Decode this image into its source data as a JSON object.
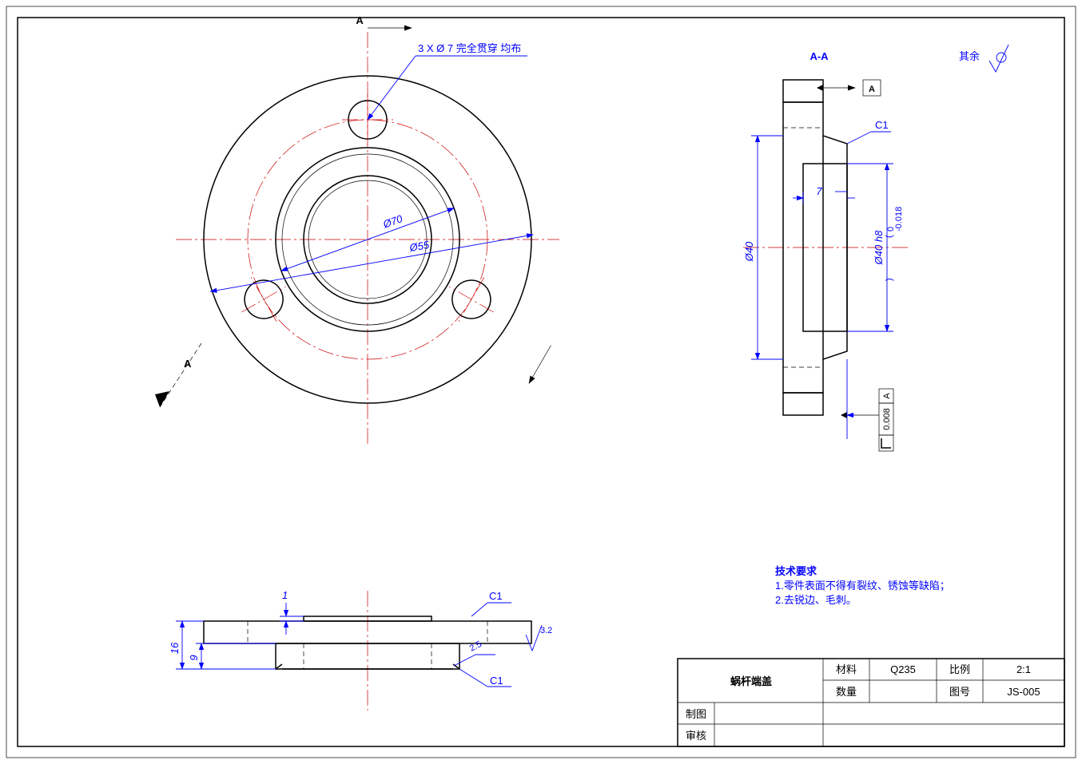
{
  "front_view": {
    "hole_callout": "3 X Ø 7 完全贯穿 均布",
    "dim1": "Ø70",
    "dim2": "Ø55",
    "section_letter_top": "A",
    "section_letter_bot": "A"
  },
  "section_view": {
    "title": "A-A",
    "datum_label": "A",
    "dim_outer": "Ø40",
    "dim_inner": "Ø40 h8",
    "tol_upper": "0",
    "tol_lower": "-0.018",
    "dim_depth": "7",
    "chamfer": "C1",
    "gdt_value": "0.008",
    "gdt_ref": "A"
  },
  "bottom_view": {
    "dim_h1": "16",
    "dim_h2": "9",
    "dim_step": "1",
    "chamfer_tr": "C1",
    "chamfer_bl": "2.5",
    "chamfer_br": "C1",
    "surf": "3.2"
  },
  "top_right": {
    "rest_label": "其余"
  },
  "notes": {
    "title": "技术要求",
    "line1": "1.零件表面不得有裂纹、锈蚀等缺陷；",
    "line2": "2.去锐边、毛刺。"
  },
  "title_block": {
    "part_name": "蜗杆端盖",
    "material_label": "材料",
    "material_value": "Q235",
    "scale_label": "比例",
    "scale_value": "2:1",
    "qty_label": "数量",
    "qty_value": "",
    "dwgno_label": "图号",
    "dwgno_value": "JS-005",
    "drawn_label": "制图",
    "checked_label": "审核"
  }
}
